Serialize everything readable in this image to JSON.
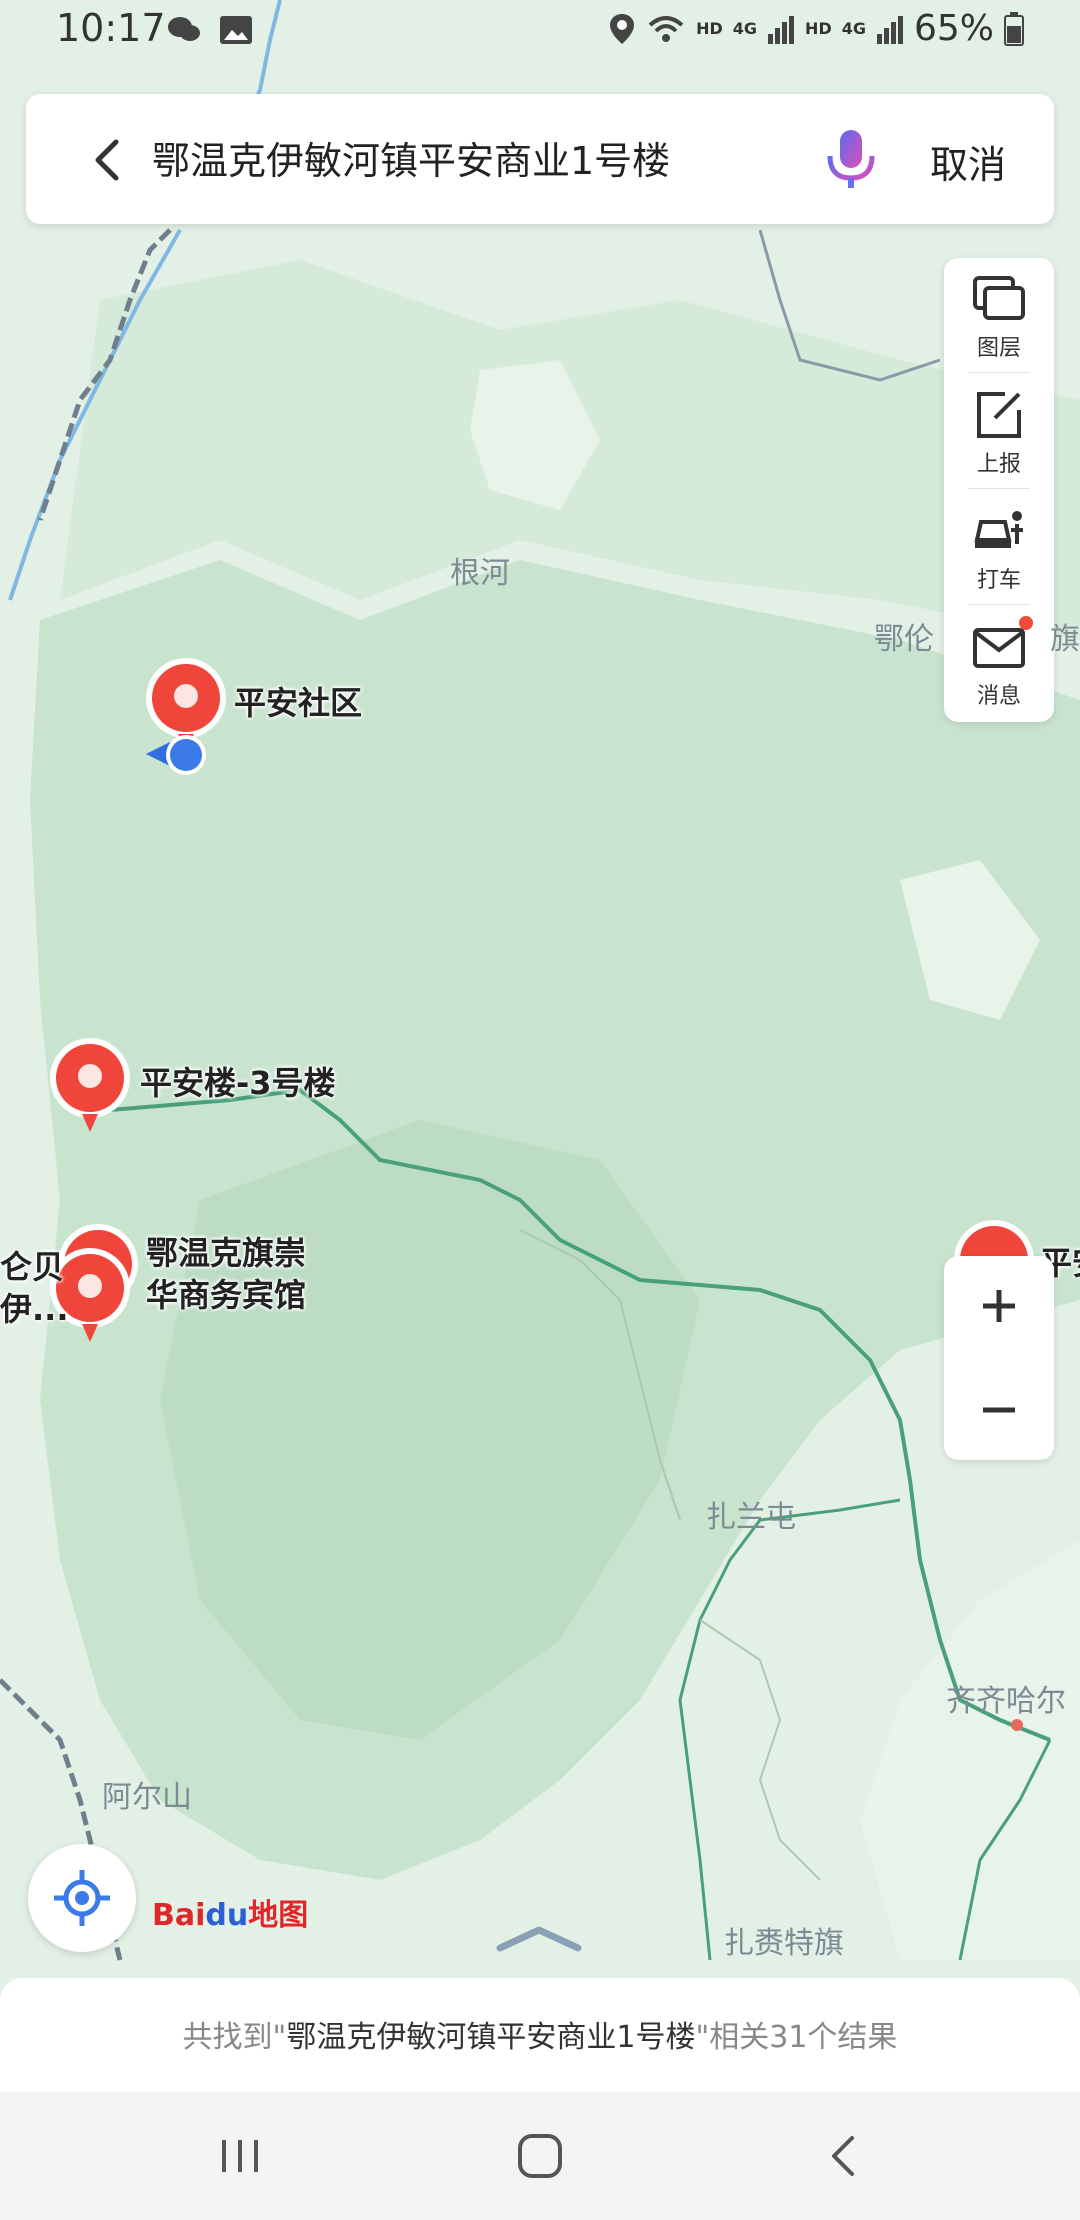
{
  "status_bar": {
    "time": "10:17",
    "net1": "HD",
    "net1_gen": "4G",
    "net2": "HD",
    "net2_gen": "4G",
    "battery": "65%"
  },
  "search": {
    "query": "鄂温克伊敏河镇平安商业1号楼",
    "cancel_label": "取消"
  },
  "tools": {
    "layers": "图层",
    "report": "上报",
    "taxi": "打车",
    "messages": "消息"
  },
  "map_labels": {
    "genhe": "根河",
    "elun": "鄂伦",
    "qi": "旗",
    "zhalantun": "扎兰屯",
    "qiqihar": "齐齐哈尔",
    "aershan": "阿尔山",
    "zhalaiteqi": "扎赉特旗"
  },
  "pois": {
    "p1": "平安社区",
    "p2": "平安楼-3号楼",
    "p3_line1": "鄂温克旗崇",
    "p3_line2": "华商务宾馆",
    "p4_line1": "仑贝",
    "p4_line2": "伊...",
    "p5": "平安"
  },
  "logo": {
    "part1": "Bai",
    "part2": "du",
    "part3": "地图"
  },
  "result": {
    "prefix": "共找到\"",
    "query": "鄂温克伊敏河镇平安商业1号楼",
    "suffix": "\"相关31个结果"
  },
  "colors": {
    "pin_red": "#f0453a",
    "accent_blue": "#3a7be8",
    "road_green": "#4aa07a",
    "forest": "#c5e2cc"
  }
}
